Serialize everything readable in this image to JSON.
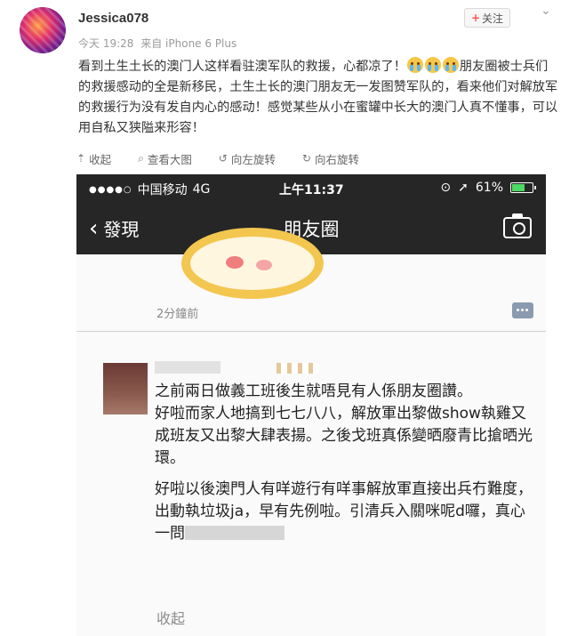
{
  "post": {
    "username": "Jessica078",
    "timestamp": "今天 19:28",
    "source": "来自 iPhone 6 Plus",
    "follow_label": "关注",
    "text_part1": "看到土生土长的澳门人这样看驻澳军队的救援，心都凉了！",
    "text_part2": "朋友圈被士兵们的救援感动的全是新移民，土生土长的澳门朋友无一发图赞军队的，看来他们对解放军的救援行为没有发自内心的感动！感觉某些从小在蜜罐中长大的澳门人真不懂事，可以用自私又狭隘来形容！"
  },
  "toolbar": [
    {
      "icon": "collapse-icon",
      "label": "收起"
    },
    {
      "icon": "zoom-icon",
      "label": "查看大图"
    },
    {
      "icon": "rotate-left-icon",
      "label": "向左旋转"
    },
    {
      "icon": "rotate-right-icon",
      "label": "向右旋转"
    }
  ],
  "screenshot": {
    "status": {
      "carrier": "中国移动",
      "network": "4G",
      "time": "上午11:37",
      "battery": "61%"
    },
    "nav": {
      "back_label": "發現",
      "title": "朋友圈"
    },
    "moment_time": "2分鐘前",
    "comment": {
      "line1": "之前兩日做義工班後生就唔見有人係朋友圈讚。",
      "line2": "好啦而家人地搞到七七八八，解放軍出黎做show執雞又成班友又出黎大肆表揚。之後戈班真係變晒廢青比搶晒光環。",
      "line3": "好啦以後澳門人有咩遊行有咩事解放軍直接出兵冇難度，出動執垃圾ja，早有先例啦。引清兵入關咪呢d囉，真心一問"
    },
    "collapse_label": "收起"
  }
}
